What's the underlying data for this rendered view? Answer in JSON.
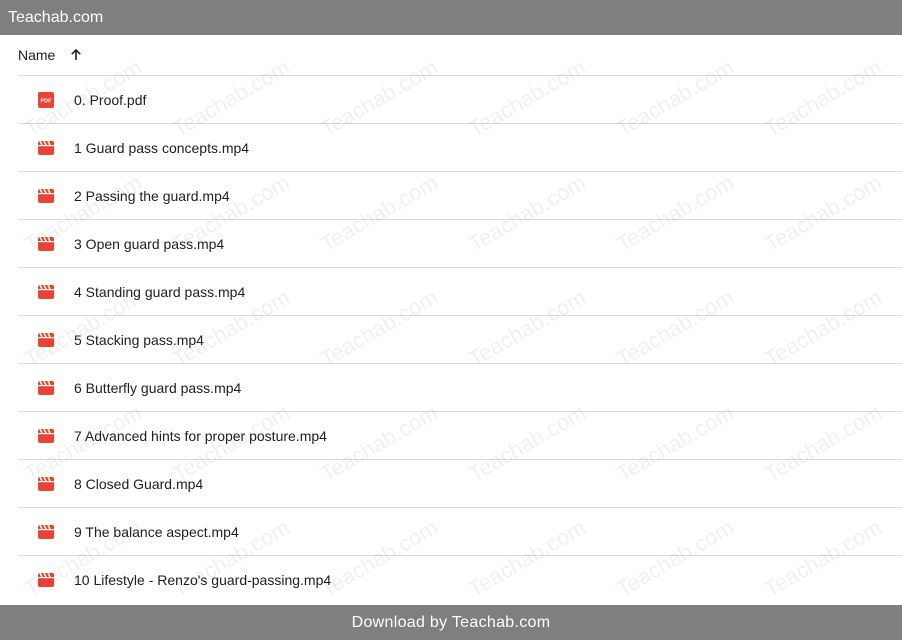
{
  "topbar": {
    "title": "Teachab.com"
  },
  "header": {
    "name_label": "Name"
  },
  "watermark_text": "Teachab.com",
  "files": [
    {
      "name": "0. Proof.pdf",
      "icon": "pdf-icon"
    },
    {
      "name": "1 Guard pass concepts.mp4",
      "icon": "video-icon"
    },
    {
      "name": "2 Passing the guard.mp4",
      "icon": "video-icon"
    },
    {
      "name": "3 Open guard pass.mp4",
      "icon": "video-icon"
    },
    {
      "name": "4 Standing guard pass.mp4",
      "icon": "video-icon"
    },
    {
      "name": "5 Stacking pass.mp4",
      "icon": "video-icon"
    },
    {
      "name": "6 Butterfly guard pass.mp4",
      "icon": "video-icon"
    },
    {
      "name": "7 Advanced hints for proper posture.mp4",
      "icon": "video-icon"
    },
    {
      "name": "8 Closed Guard.mp4",
      "icon": "video-icon"
    },
    {
      "name": "9 The balance aspect.mp4",
      "icon": "video-icon"
    },
    {
      "name": "10 Lifestyle - Renzo's guard-passing.mp4",
      "icon": "video-icon"
    }
  ],
  "footer": {
    "text": "Download by Teachab.com"
  },
  "colors": {
    "bar": "#7f7f7f",
    "file_icon_red": "#ea4335",
    "divider": "#dadce0"
  }
}
